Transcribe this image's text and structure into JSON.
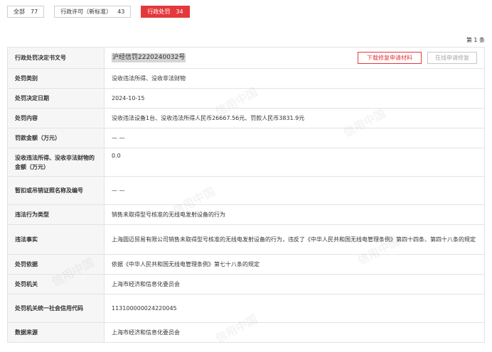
{
  "tabs": [
    {
      "label": "全部",
      "count": "77"
    },
    {
      "label": "行政许可（新标准）",
      "count": "43"
    },
    {
      "label": "行政处罚",
      "count": "34"
    }
  ],
  "pager": {
    "text": "第 1 条"
  },
  "buttons": {
    "download_label": "下载修复申请材料",
    "online_label": "在线申请修复"
  },
  "watermark": "信用中国",
  "rows": [
    {
      "key": "行政处罚决定书文号",
      "value": "沪经信罚2220240032号"
    },
    {
      "key": "处罚类别",
      "value": "没收违法所得、没收非法财物"
    },
    {
      "key": "处罚决定日期",
      "value": "2024-10-15"
    },
    {
      "key": "处罚内容",
      "value": "没收违法设备1台、没收违法所得人民币26667.56元、罚款人民币3831.9元"
    },
    {
      "key": "罚款金额（万元）",
      "value": "— —"
    },
    {
      "key": "没收违法所得、没收非法财物的金额（万元）",
      "value": "0.0"
    },
    {
      "key": "暂扣或吊销证照名称及编号",
      "value": "— —"
    },
    {
      "key": "违法行为类型",
      "value": "销售未取得型号核准的无线电发射设备的行为"
    },
    {
      "key": "违法事实",
      "value": "上海圆迈贸易有限公司销售未取得型号核准的无线电发射设备的行为，违反了《中华人民共和国无线电管理条例》第四十四条、第四十八条的规定"
    },
    {
      "key": "处罚依据",
      "value": "依据《中华人民共和国无线电管理条例》第七十八条的规定"
    },
    {
      "key": "处罚机关",
      "value": "上海市经济和信息化委员会"
    },
    {
      "key": "处罚机关统一社会信用代码",
      "value": "11310000002422004​5"
    },
    {
      "key": "数据来源",
      "value": "上海市经济和信息化委员会"
    }
  ]
}
